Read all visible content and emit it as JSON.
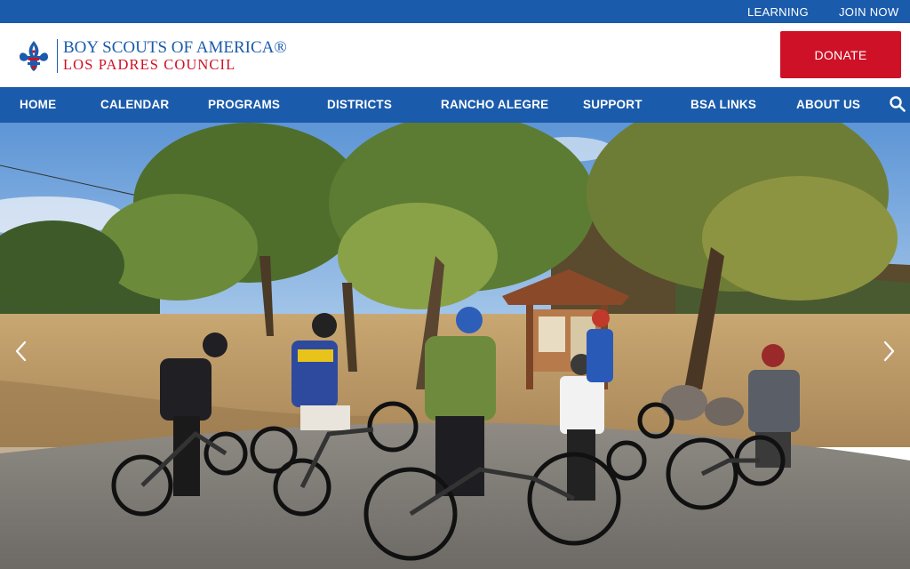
{
  "utility": {
    "learning_label": "LEARNING",
    "join_label": "JOIN NOW"
  },
  "header": {
    "logo_line1": "BOY SCOUTS OF AMERICA®",
    "logo_line2": "LOS PADRES COUNCIL",
    "donate_label": "DONATE"
  },
  "nav": {
    "items": [
      {
        "label": "HOME"
      },
      {
        "label": "CALENDAR"
      },
      {
        "label": "PROGRAMS"
      },
      {
        "label": "DISTRICTS"
      },
      {
        "label": "RANCHO ALEGRE"
      },
      {
        "label": "SUPPORT"
      },
      {
        "label": "BSA LINKS"
      },
      {
        "label": "ABOUT US"
      }
    ],
    "search_icon": "search-icon"
  },
  "hero": {
    "image_alt": "Scouts on mountain bikes gathered at a trailhead sign under oak trees",
    "prev_icon": "chevron-left-icon",
    "next_icon": "chevron-right-icon"
  },
  "colors": {
    "brand_blue": "#1b5bab",
    "brand_red": "#ce1126",
    "white": "#ffffff"
  }
}
